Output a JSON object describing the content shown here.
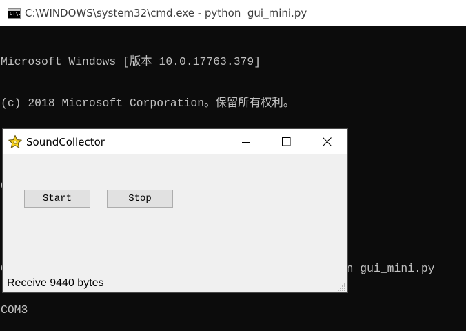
{
  "cmd_window": {
    "title": "C:\\WINDOWS\\system32\\cmd.exe - python  gui_mini.py",
    "icon": "cmd-icon",
    "icon_text": "C:\\."
  },
  "console": {
    "lines": [
      "Microsoft Windows [版本 10.0.17763.379]",
      "(c) 2018 Microsoft Corporation。保留所有权利。",
      "",
      "C:\\Users\\LiRen>cd Desktop\\SoundCollector\\Scripts",
      "",
      "C:\\Users\\LiRen\\Desktop\\SoundCollector\\Scripts>python gui_mini.py",
      "COM3"
    ]
  },
  "app_window": {
    "title": "SoundCollector",
    "icon": "feather-icon",
    "controls": {
      "minimize": "minimize-icon",
      "maximize": "maximize-icon",
      "close": "close-icon"
    },
    "buttons": {
      "start_label": "Start",
      "stop_label": "Stop"
    },
    "status_text": "Receive 9440 bytes"
  },
  "colors": {
    "console_bg": "#0c0c0c",
    "console_text": "#c0c0c0",
    "window_bg": "#f0f0f0",
    "button_bg": "#e1e1e1",
    "icon_yellow": "#f8d21c"
  }
}
